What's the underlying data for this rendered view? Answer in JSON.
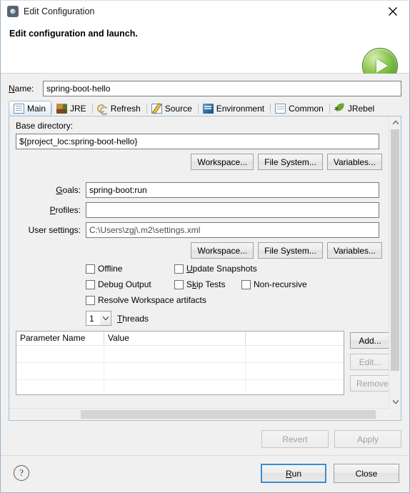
{
  "window": {
    "title": "Edit Configuration",
    "icon": "gear-icon",
    "close_label": "×"
  },
  "header": {
    "title": "Edit configuration and launch.",
    "badge_icon": "green-run-play-icon"
  },
  "name_row": {
    "label": "Name:",
    "value": "spring-boot-hello"
  },
  "tabs": [
    {
      "label": "Main",
      "icon": "main-tab-icon",
      "selected": true
    },
    {
      "label": "JRE",
      "icon": "jre-tab-icon",
      "selected": false
    },
    {
      "label": "Refresh",
      "icon": "refresh-tab-icon",
      "selected": false
    },
    {
      "label": "Source",
      "icon": "source-tab-icon",
      "selected": false
    },
    {
      "label": "Environment",
      "icon": "environment-tab-icon",
      "selected": false
    },
    {
      "label": "Common",
      "icon": "common-tab-icon",
      "selected": false
    },
    {
      "label": "JRebel",
      "icon": "jrebel-tab-icon",
      "selected": false
    }
  ],
  "main_tab": {
    "base_directory": {
      "label": "Base directory:",
      "value": "${project_loc:spring-boot-hello}"
    },
    "base_dir_buttons": [
      {
        "label": "Workspace...",
        "name": "workspace-button-base",
        "disabled": false
      },
      {
        "label": "File System...",
        "name": "file-system-button-base",
        "disabled": false
      },
      {
        "label": "Variables...",
        "name": "variables-button-base",
        "disabled": false
      }
    ],
    "goals": {
      "label": "Goals:",
      "value": "spring-boot:run",
      "placeholder": ""
    },
    "profiles": {
      "label": "Profiles:",
      "value": "",
      "placeholder": ""
    },
    "user_settings": {
      "label": "User settings:",
      "value": "C:\\Users\\zgj\\.m2\\settings.xml",
      "placeholder": ""
    },
    "settings_buttons": [
      {
        "label": "Workspace...",
        "name": "workspace-button-settings",
        "disabled": false
      },
      {
        "label": "File System...",
        "name": "file-system-button-settings",
        "disabled": false
      },
      {
        "label": "Variables...",
        "name": "variables-button-settings",
        "disabled": false
      }
    ],
    "checkboxes": [
      {
        "label": "Offline",
        "name": "offline-checkbox",
        "checked": false
      },
      {
        "label": "Update Snapshots",
        "name": "update-snapshots-checkbox",
        "checked": false
      },
      {
        "label": "Debug Output",
        "name": "debug-output-checkbox",
        "checked": false
      },
      {
        "label": "Skip Tests",
        "name": "skip-tests-checkbox",
        "checked": false
      },
      {
        "label": "Non-recursive",
        "name": "non-recursive-checkbox",
        "checked": false
      },
      {
        "label": "Resolve Workspace artifacts",
        "name": "resolve-workspace-checkbox",
        "checked": false
      }
    ],
    "threads": {
      "value": "1",
      "label": "Threads",
      "options": [
        "1"
      ]
    },
    "parameters_table": {
      "columns": [
        "Parameter Name",
        "Value",
        ""
      ],
      "rows": []
    },
    "table_buttons": [
      {
        "label": "Add...",
        "name": "add-parameter-button",
        "disabled": false
      },
      {
        "label": "Edit...",
        "name": "edit-parameter-button",
        "disabled": true
      },
      {
        "label": "Remove",
        "name": "remove-parameter-button",
        "disabled": true
      }
    ],
    "revert_button": {
      "label": "Revert",
      "disabled": true
    },
    "apply_button": {
      "label": "Apply",
      "disabled": true
    }
  },
  "footer": {
    "help_label": "?",
    "run_button": {
      "label": "Run",
      "focused": true
    },
    "close_button": {
      "label": "Close",
      "focused": false
    }
  },
  "colors": {
    "dialog_bg": "#f0f0f0",
    "panel_border": "#a8c0d4",
    "field_border": "#7b7b7b",
    "focus_blue": "#3a8cd4",
    "run_green": "#6fb33b",
    "disabled_text": "#a2a2a2"
  }
}
